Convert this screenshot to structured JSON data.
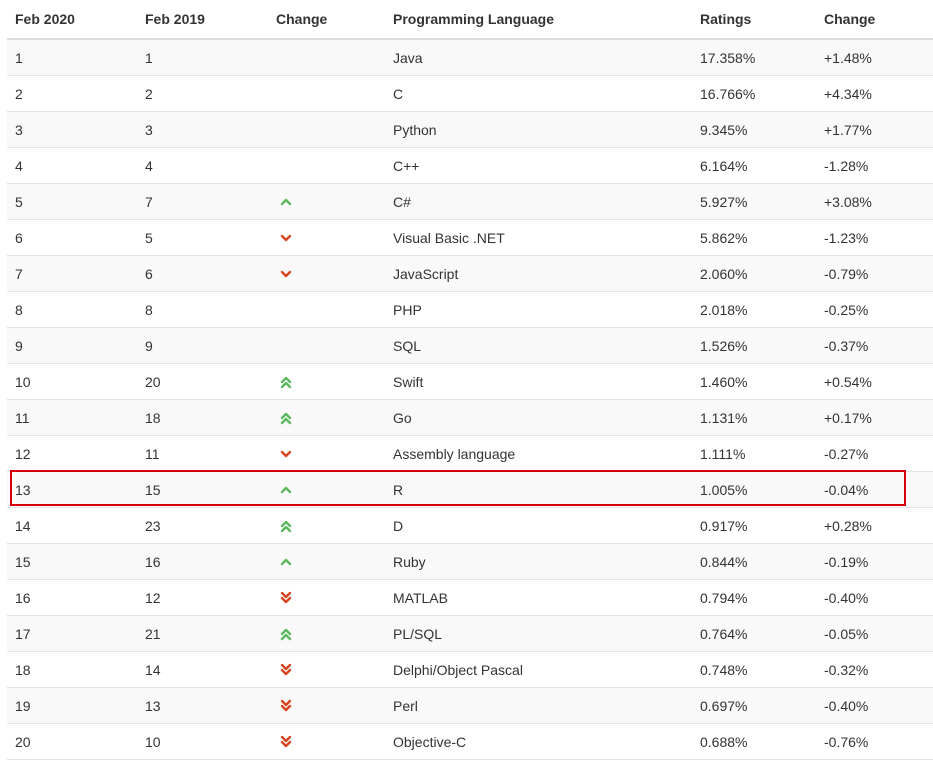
{
  "headers": [
    "Feb 2020",
    "Feb 2019",
    "Change",
    "Programming Language",
    "Ratings",
    "Change"
  ],
  "colors": {
    "up": "#5cb85c",
    "down": "#d9431e",
    "highlight": "#d6000c"
  },
  "rows": [
    {
      "feb2020": "1",
      "feb2019": "1",
      "trend": "none",
      "language": "Java",
      "rating": "17.358%",
      "change": "+1.48%"
    },
    {
      "feb2020": "2",
      "feb2019": "2",
      "trend": "none",
      "language": "C",
      "rating": "16.766%",
      "change": "+4.34%"
    },
    {
      "feb2020": "3",
      "feb2019": "3",
      "trend": "none",
      "language": "Python",
      "rating": "9.345%",
      "change": "+1.77%"
    },
    {
      "feb2020": "4",
      "feb2019": "4",
      "trend": "none",
      "language": "C++",
      "rating": "6.164%",
      "change": "-1.28%"
    },
    {
      "feb2020": "5",
      "feb2019": "7",
      "trend": "up",
      "language": "C#",
      "rating": "5.927%",
      "change": "+3.08%"
    },
    {
      "feb2020": "6",
      "feb2019": "5",
      "trend": "down",
      "language": "Visual Basic .NET",
      "rating": "5.862%",
      "change": "-1.23%"
    },
    {
      "feb2020": "7",
      "feb2019": "6",
      "trend": "down",
      "language": "JavaScript",
      "rating": "2.060%",
      "change": "-0.79%"
    },
    {
      "feb2020": "8",
      "feb2019": "8",
      "trend": "none",
      "language": "PHP",
      "rating": "2.018%",
      "change": "-0.25%"
    },
    {
      "feb2020": "9",
      "feb2019": "9",
      "trend": "none",
      "language": "SQL",
      "rating": "1.526%",
      "change": "-0.37%"
    },
    {
      "feb2020": "10",
      "feb2019": "20",
      "trend": "double-up",
      "language": "Swift",
      "rating": "1.460%",
      "change": "+0.54%"
    },
    {
      "feb2020": "11",
      "feb2019": "18",
      "trend": "double-up",
      "language": "Go",
      "rating": "1.131%",
      "change": "+0.17%"
    },
    {
      "feb2020": "12",
      "feb2019": "11",
      "trend": "down",
      "language": "Assembly language",
      "rating": "1.111%",
      "change": "-0.27%"
    },
    {
      "feb2020": "13",
      "feb2019": "15",
      "trend": "up",
      "language": "R",
      "rating": "1.005%",
      "change": "-0.04%",
      "highlighted": true
    },
    {
      "feb2020": "14",
      "feb2019": "23",
      "trend": "double-up",
      "language": "D",
      "rating": "0.917%",
      "change": "+0.28%"
    },
    {
      "feb2020": "15",
      "feb2019": "16",
      "trend": "up",
      "language": "Ruby",
      "rating": "0.844%",
      "change": "-0.19%"
    },
    {
      "feb2020": "16",
      "feb2019": "12",
      "trend": "double-down",
      "language": "MATLAB",
      "rating": "0.794%",
      "change": "-0.40%"
    },
    {
      "feb2020": "17",
      "feb2019": "21",
      "trend": "double-up",
      "language": "PL/SQL",
      "rating": "0.764%",
      "change": "-0.05%"
    },
    {
      "feb2020": "18",
      "feb2019": "14",
      "trend": "double-down",
      "language": "Delphi/Object Pascal",
      "rating": "0.748%",
      "change": "-0.32%"
    },
    {
      "feb2020": "19",
      "feb2019": "13",
      "trend": "double-down",
      "language": "Perl",
      "rating": "0.697%",
      "change": "-0.40%"
    },
    {
      "feb2020": "20",
      "feb2019": "10",
      "trend": "double-down",
      "language": "Objective-C",
      "rating": "0.688%",
      "change": "-0.76%"
    }
  ]
}
